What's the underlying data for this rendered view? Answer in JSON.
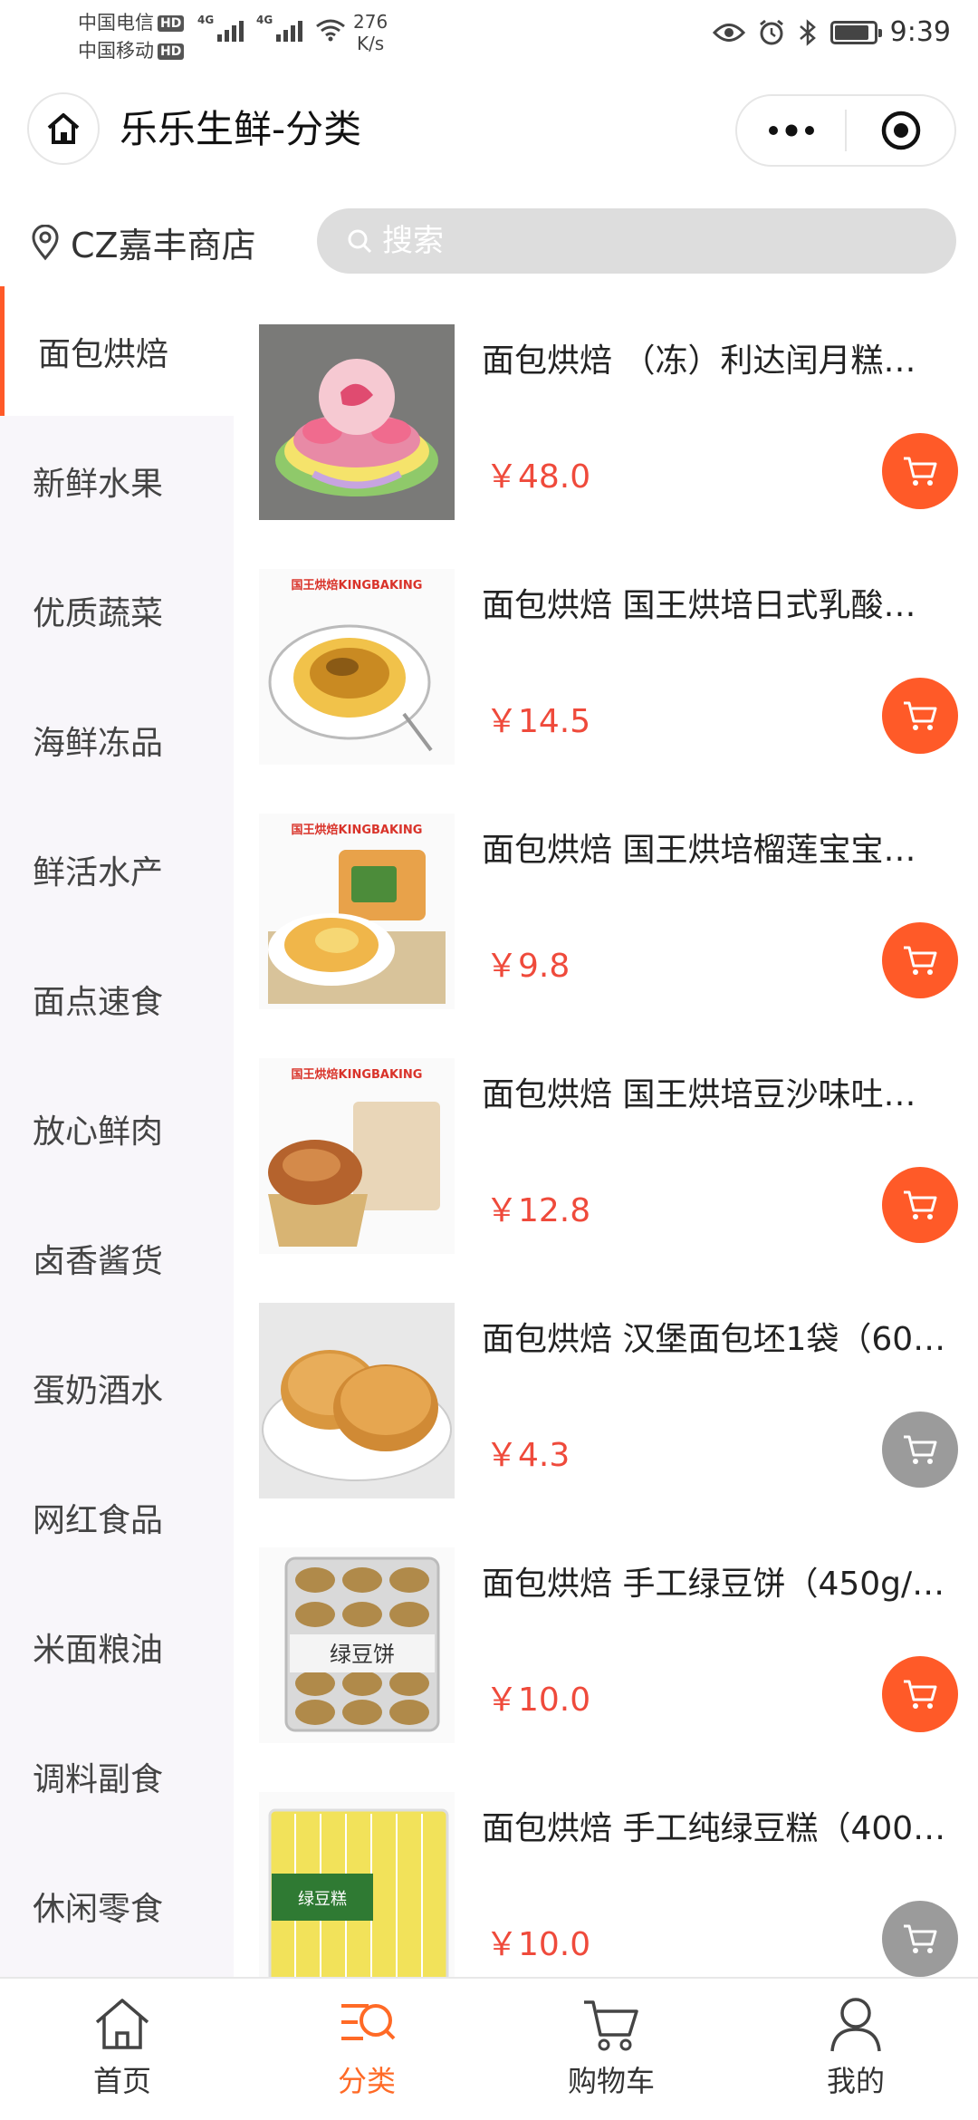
{
  "status_bar": {
    "carrier1": "中国电信",
    "carrier2": "中国移动",
    "hd": "HD",
    "net1": "4G",
    "net2": "4G",
    "speed_value": "276",
    "speed_unit": "K/s",
    "time": "9:39",
    "icons": [
      "eye-icon",
      "alarm-icon",
      "bluetooth-icon",
      "battery-icon"
    ],
    "battery_level": 0.85
  },
  "header": {
    "title": "乐乐生鲜-分类",
    "home_icon": "home-icon",
    "menu_icon": "more-dots-icon",
    "close_icon": "target-icon"
  },
  "store": {
    "name": "CZ嘉丰商店",
    "icon": "location-pin-icon"
  },
  "search": {
    "placeholder": "搜索",
    "icon": "search-icon"
  },
  "categories": [
    {
      "label": "面包烘焙",
      "active": true
    },
    {
      "label": "新鲜水果",
      "active": false
    },
    {
      "label": "优质蔬菜",
      "active": false
    },
    {
      "label": "海鲜冻品",
      "active": false
    },
    {
      "label": "鲜活水产",
      "active": false
    },
    {
      "label": "面点速食",
      "active": false
    },
    {
      "label": "放心鲜肉",
      "active": false
    },
    {
      "label": "卤香酱货",
      "active": false
    },
    {
      "label": "蛋奶酒水",
      "active": false
    },
    {
      "label": "网红食品",
      "active": false
    },
    {
      "label": "米面粮油",
      "active": false
    },
    {
      "label": "调料副食",
      "active": false
    },
    {
      "label": "休闲零食",
      "active": false
    }
  ],
  "products": [
    {
      "name": "面包烘焙 （冻）利达闰月糕…",
      "price": "￥48.0",
      "cart_enabled": true,
      "image": "birthday-peach-cake",
      "brand_text": ""
    },
    {
      "name": "面包烘焙 国王烘培日式乳酸…",
      "price": "￥14.5",
      "cart_enabled": true,
      "image": "custard-tart",
      "brand_text": "国王烘焙KINGBAKING"
    },
    {
      "name": "面包烘焙 国王烘培榴莲宝宝…",
      "price": "￥9.8",
      "cart_enabled": true,
      "image": "durian-pastry",
      "brand_text": "国王烘焙KINGBAKING"
    },
    {
      "name": "面包烘焙 国王烘培豆沙味吐…",
      "price": "￥12.8",
      "cart_enabled": true,
      "image": "bean-paste-bread",
      "brand_text": "国王烘焙KINGBAKING"
    },
    {
      "name": "面包烘焙 汉堡面包坯1袋（60…",
      "price": "￥4.3",
      "cart_enabled": false,
      "image": "burger-buns",
      "brand_text": ""
    },
    {
      "name": "面包烘焙 手工绿豆饼（450g/…",
      "price": "￥10.0",
      "cart_enabled": true,
      "image": "mung-bean-cakes",
      "brand_text": "绿豆饼"
    },
    {
      "name": "面包烘焙 手工纯绿豆糕（400…",
      "price": "￥10.0",
      "cart_enabled": false,
      "image": "mung-bean-pastry",
      "brand_text": "绿豆糕"
    }
  ],
  "tabbar": [
    {
      "label": "首页",
      "icon": "home-outline-icon",
      "active": false
    },
    {
      "label": "分类",
      "icon": "category-search-icon",
      "active": true
    },
    {
      "label": "购物车",
      "icon": "cart-outline-icon",
      "active": false
    },
    {
      "label": "我的",
      "icon": "person-icon",
      "active": false
    }
  ],
  "colors": {
    "accent": "#ff5a28",
    "price": "#ef4a3b",
    "tab_active": "#ff6a26",
    "cart_disabled": "#9b9b9b",
    "sidebar_bg": "#f8f6fa"
  }
}
